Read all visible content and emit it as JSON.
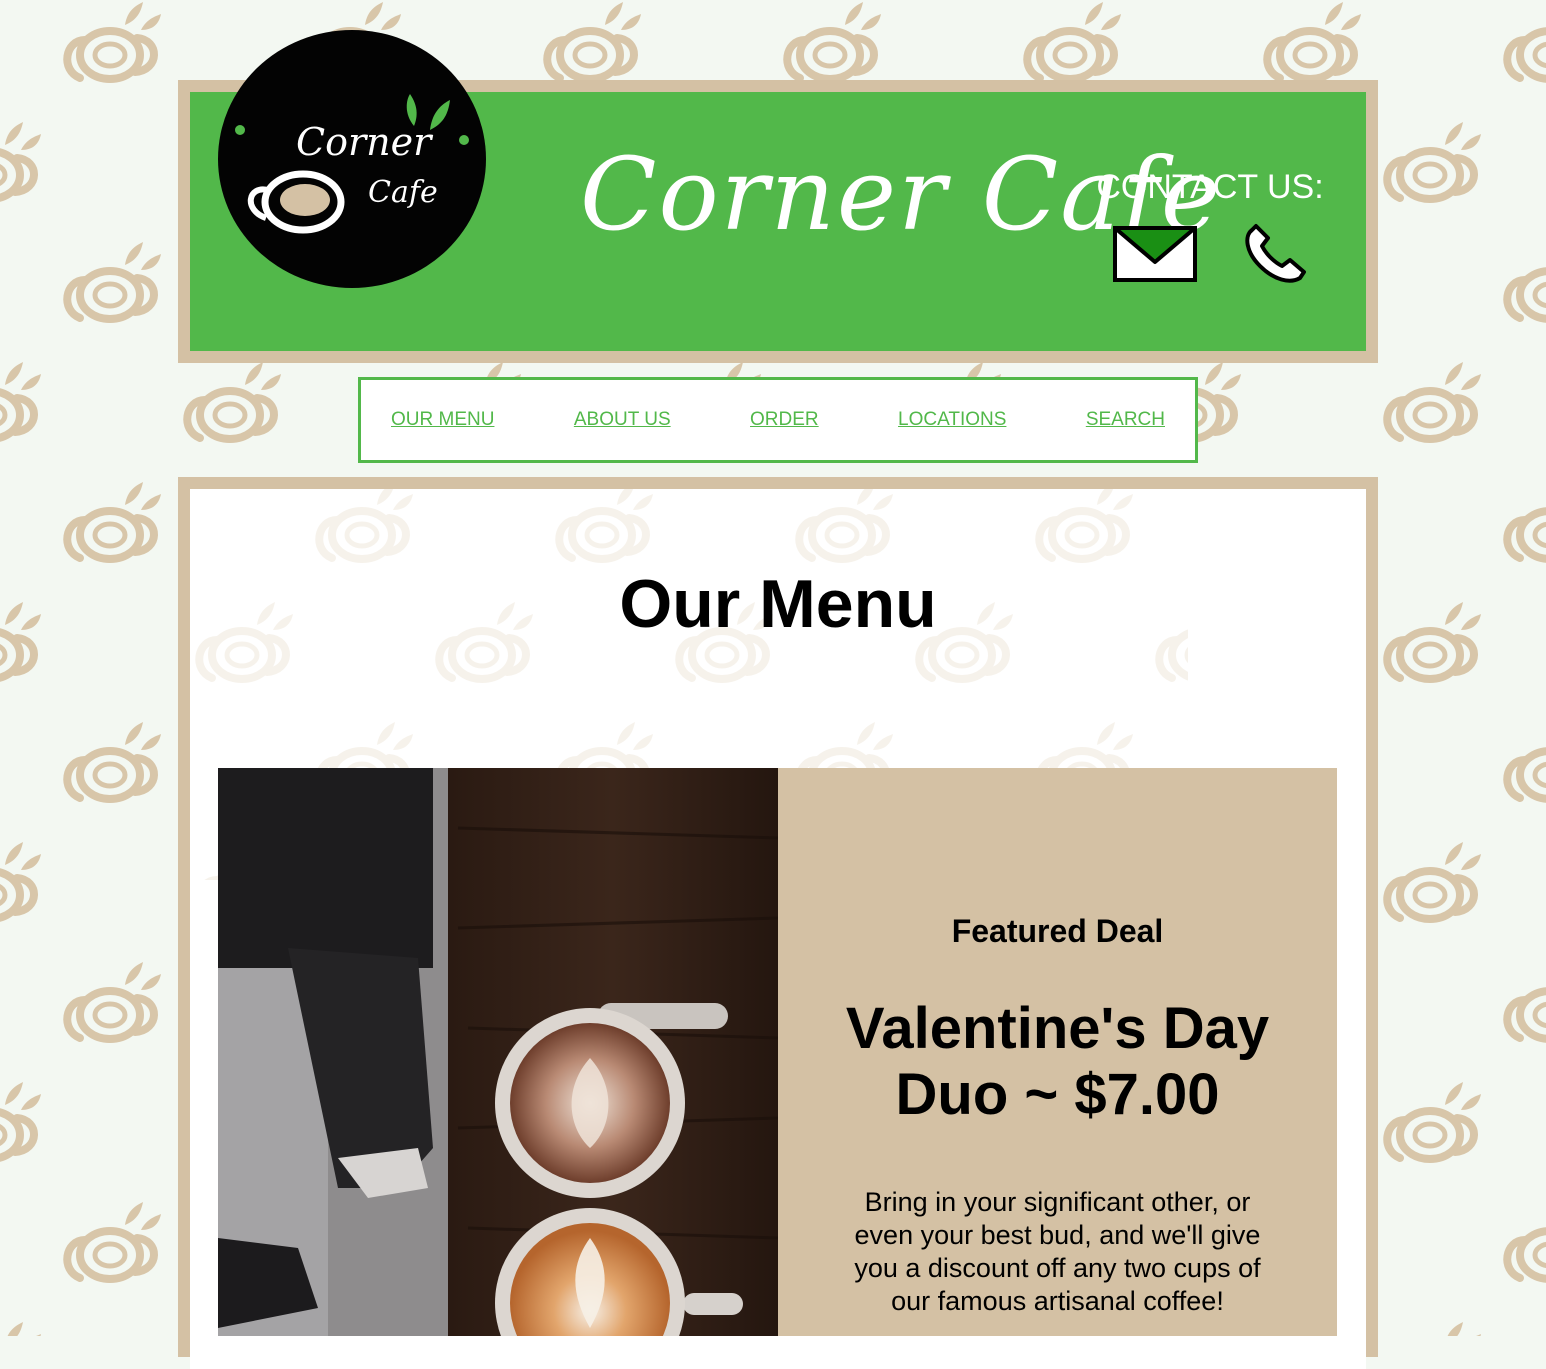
{
  "header": {
    "logo": {
      "line1": "Corner",
      "line2": "Cafe"
    },
    "site_title": "Corner Cafe",
    "contact_label": "CONTACT US:",
    "icons": [
      "mail-icon",
      "phone-icon"
    ]
  },
  "nav": {
    "items": [
      {
        "label": "OUR MENU"
      },
      {
        "label": "ABOUT US"
      },
      {
        "label": "ORDER"
      },
      {
        "label": "LOCATIONS"
      },
      {
        "label": "SEARCH"
      }
    ]
  },
  "main": {
    "title": "Our Menu",
    "featured": {
      "kicker": "Featured Deal",
      "title_line1": "Valentine's Day",
      "title_line2": "Duo ~ $7.00",
      "description": "Bring in your significant other, or even your best bud, and we'll give you a discount off any two cups of our famous artisanal coffee!"
    }
  },
  "colors": {
    "brand_green": "#52b84a",
    "tan": "#d4c1a4",
    "page_bg": "#f3f8f2"
  }
}
